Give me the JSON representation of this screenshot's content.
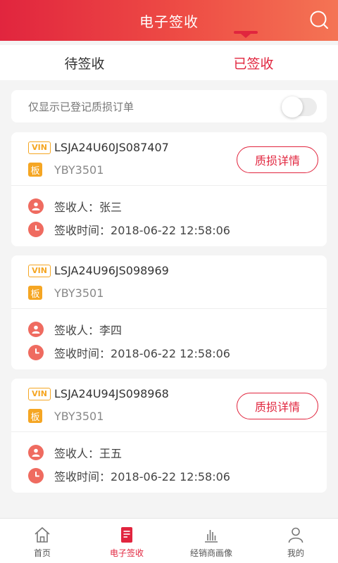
{
  "header": {
    "title": "电子签收"
  },
  "tabs": [
    {
      "label": "待签收",
      "active": false
    },
    {
      "label": "已签收",
      "active": true
    }
  ],
  "filter": {
    "label": "仅显示已登记质损订单",
    "enabled": false
  },
  "vin_badge": "VIN",
  "plate_badge": "板",
  "signer_prefix": "签收人：",
  "time_prefix": "签收时间：",
  "orders": [
    {
      "vin": "LSJA24U60JS087407",
      "plate": "YBY3501",
      "signer": "张三",
      "time": "2018-06-22 12:58:06",
      "detail_button": "质损详情"
    },
    {
      "vin": "LSJA24U96JS098969",
      "plate": "YBY3501",
      "signer": "李四",
      "time": "2018-06-22 12:58:06",
      "detail_button": null
    },
    {
      "vin": "LSJA24U94JS098968",
      "plate": "YBY3501",
      "signer": "王五",
      "time": "2018-06-22 12:58:06",
      "detail_button": "质损详情"
    }
  ],
  "nav": [
    {
      "label": "首页",
      "icon": "home-icon",
      "active": false
    },
    {
      "label": "电子签收",
      "icon": "document-icon",
      "active": true
    },
    {
      "label": "经销商画像",
      "icon": "bar-chart-icon",
      "active": false
    },
    {
      "label": "我的",
      "icon": "user-icon",
      "active": false
    }
  ],
  "colors": {
    "accent": "#e1253e",
    "badge": "#f5a623",
    "icon": "#ef6b60"
  }
}
